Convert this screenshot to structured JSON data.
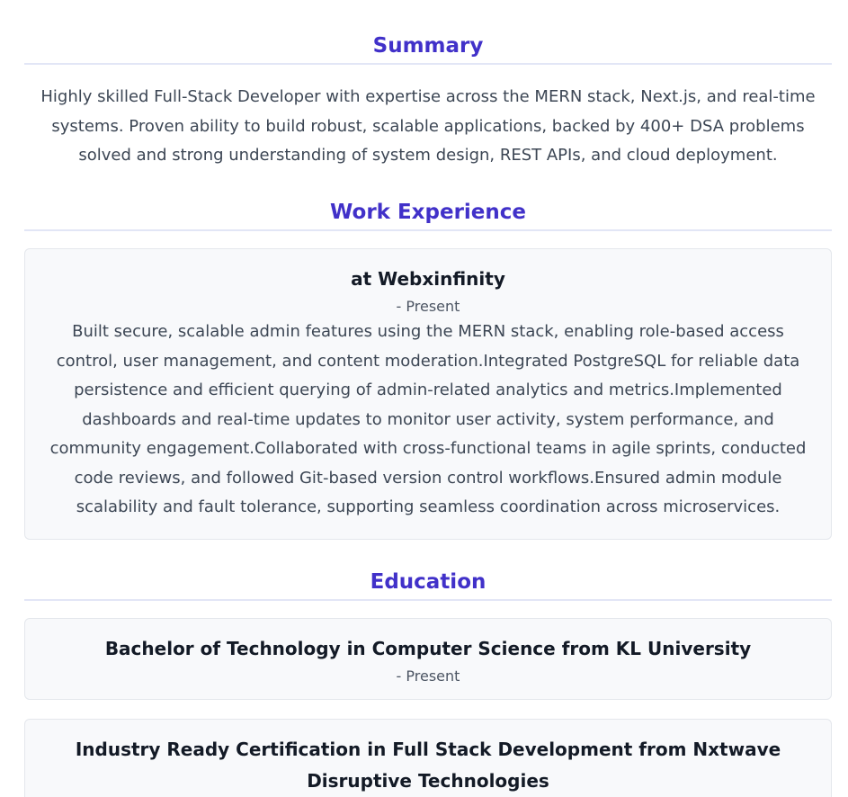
{
  "summary": {
    "heading": "Summary",
    "text": "Highly skilled Full-Stack Developer with expertise across the MERN stack, Next.js, and real-time systems. Proven ability to build robust, scalable applications, backed by 400+ DSA problems solved and strong understanding of system design, REST APIs, and cloud deployment."
  },
  "work_experience": {
    "heading": "Work Experience",
    "items": [
      {
        "title": "at Webxinfinity",
        "date": "- Present",
        "description": "Built secure, scalable admin features using the MERN stack, enabling role-based access control, user management, and content moderation.Integrated PostgreSQL for reliable data persistence and efficient querying of admin-related analytics and metrics.Implemented dashboards and real-time updates to monitor user activity, system performance, and community engagement.Collaborated with cross-functional teams in agile sprints, conducted code reviews, and followed Git-based version control workflows.Ensured admin module scalability and fault tolerance, supporting seamless coordination across microservices."
      }
    ]
  },
  "education": {
    "heading": "Education",
    "items": [
      {
        "title": "Bachelor of Technology in Computer Science from KL University",
        "date": "- Present"
      },
      {
        "title": "Industry Ready Certification in Full Stack Development from Nxtwave Disruptive Technologies"
      }
    ]
  }
}
